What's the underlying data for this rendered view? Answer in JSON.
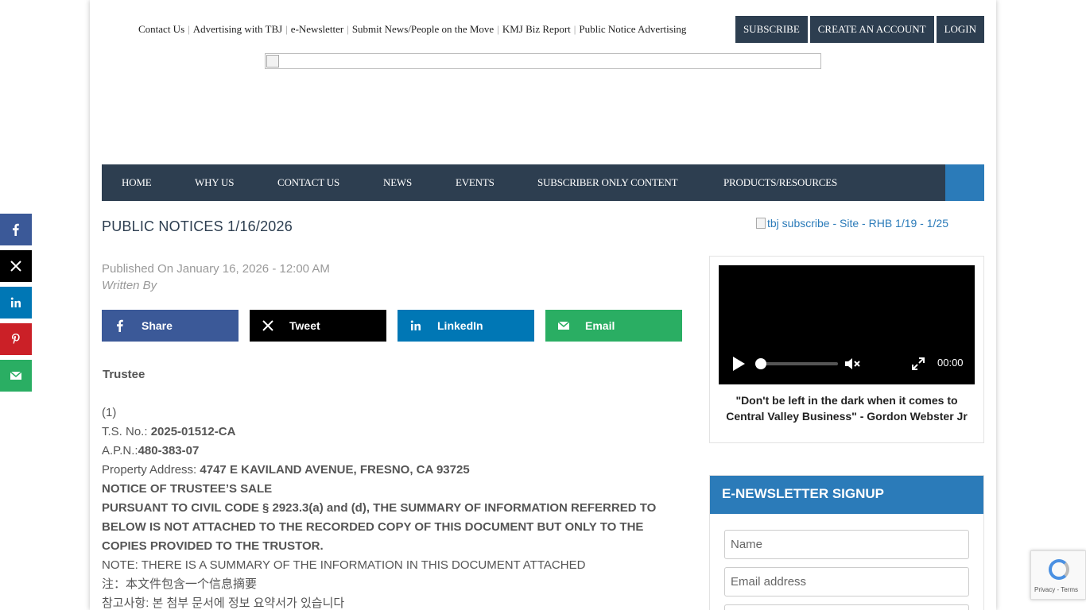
{
  "top_links": [
    "Contact Us",
    "Advertising with TBJ",
    "e-Newsletter",
    "Submit News/People on the Move",
    "KMJ Biz Report",
    "Public Notice Advertising"
  ],
  "account_buttons": {
    "subscribe": "SUBSCRIBE",
    "create": "CREATE AN ACCOUNT",
    "login": "LOGIN"
  },
  "nav": [
    "HOME",
    "WHY US",
    "CONTACT US",
    "NEWS",
    "EVENTS",
    "SUBSCRIBER ONLY CONTENT",
    "PRODUCTS/RESOURCES"
  ],
  "article": {
    "title": "PUBLIC NOTICES 1/16/2026",
    "published": "Published On January 16, 2026 - 12:00 AM",
    "written_by": "Written By",
    "heading": "Trustee",
    "item_number": "(1)",
    "ts_label": "T.S. No.: ",
    "ts_value": "2025-01512-CA",
    "apn_label": "A.P.N.:",
    "apn_value": "480-383-07",
    "address_label": "Property Address: ",
    "address_value": "4747 E KAVILAND AVENUE, FRESNO, CA 93725",
    "notice_title": "NOTICE OF TRUSTEE’S SALE",
    "pursuant": "PURSUANT TO CIVIL CODE § 2923.3(a) and (d), THE SUMMARY OF INFORMATION REFERRED TO BELOW IS NOT ATTACHED TO THE RECORDED COPY OF THIS DOCUMENT BUT ONLY TO THE COPIES PROVIDED TO THE TRUSTOR.",
    "note": "NOTE: THERE IS A SUMMARY OF THE INFORMATION IN THIS DOCUMENT ATTACHED",
    "note_zh": "注：本文件包含一个信息摘要",
    "note_ko": "참고사항: 본 첨부 문서에 정보 요약서가 있습니다"
  },
  "share_buttons": {
    "facebook": "Share",
    "x": "Tweet",
    "linkedin": "LinkedIn",
    "email": "Email"
  },
  "share_colors": {
    "facebook": "#3b5998",
    "x": "#000000",
    "linkedin": "#0077b5",
    "pinterest": "#cb2027",
    "email": "#2aae63"
  },
  "sidebar": {
    "promo_alt": "tbj subscribe - Site - RHB 1/19 - 1/25",
    "video_time": "00:00",
    "video_caption": "\"Don't be left in the dark when it comes to Central Valley Business\" - Gordon Webster Jr",
    "newsletter_title": "E-NEWSLETTER SIGNUP",
    "name_placeholder": "Name",
    "email_placeholder": "Email address"
  },
  "recaptcha": {
    "privacy": "Privacy",
    "terms": "Terms"
  }
}
